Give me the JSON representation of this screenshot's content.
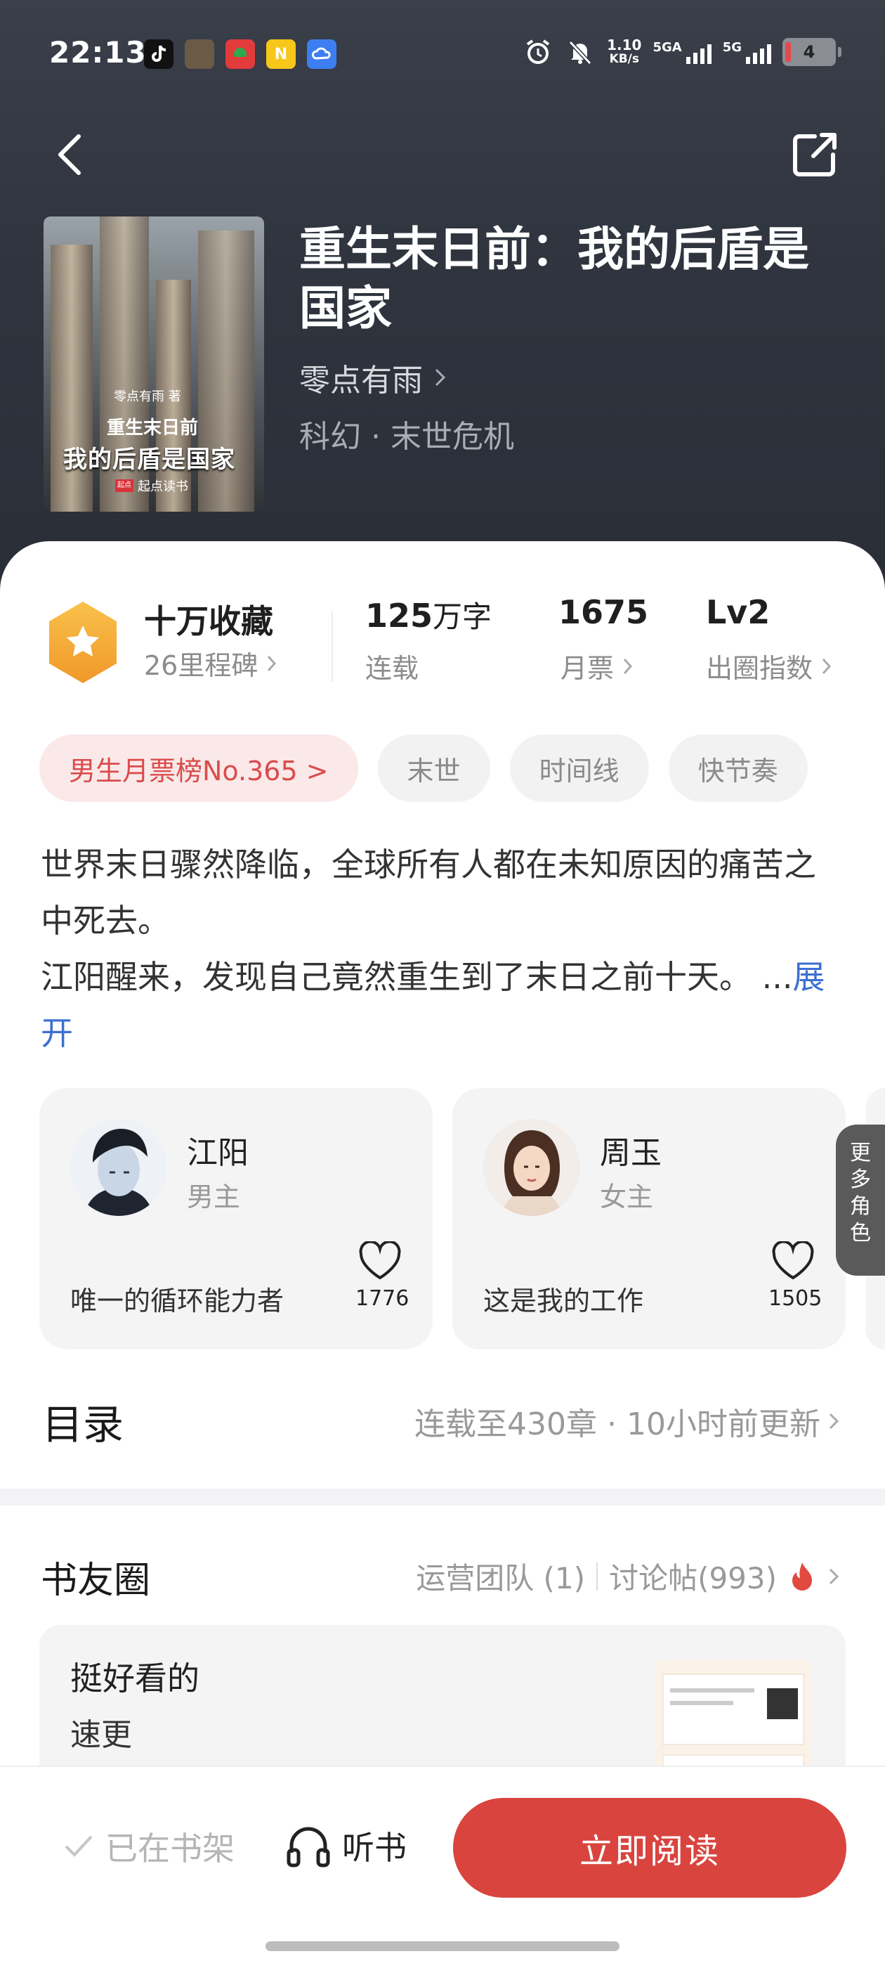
{
  "status_bar": {
    "time": "22:13",
    "net_speed_value": "1.10",
    "net_speed_unit": "KB/s",
    "sim1_label": "5GA",
    "sim2_label": "5G",
    "battery_level": "4"
  },
  "book": {
    "title": "重生末日前：我的后盾是国家",
    "author": "零点有雨",
    "genre": "科幻 · 末世危机",
    "cover": {
      "author_line": "零点有雨 著",
      "title_line1": "重生末日前",
      "title_line2": "我的后盾是国家",
      "publisher_badge": "起点",
      "publisher": "起点读书"
    }
  },
  "stats": {
    "collect_main": "十万收藏",
    "collect_sub": "26里程碑",
    "words_value": "125",
    "words_unit": "万字",
    "words_sub": "连载",
    "votes_value": "1675",
    "votes_sub": "月票",
    "level_value": "Lv2",
    "level_sub": "出圈指数"
  },
  "tags": [
    "男生月票榜No.365 >",
    "末世",
    "时间线",
    "快节奏"
  ],
  "synopsis": {
    "line1": "世界末日骤然降临，全球所有人都在未知原因的痛苦之中死去。",
    "line2": "江阳醒来，发现自己竟然重生到了末日之前十天。",
    "ellipsis": "...",
    "expand": "展开"
  },
  "characters": [
    {
      "name": "江阳",
      "role": "男主",
      "desc": "唯一的循环能力者",
      "likes": "1776"
    },
    {
      "name": "周玉",
      "role": "女主",
      "desc": "这是我的工作",
      "likes": "1505"
    }
  ],
  "more_characters": "更多角色",
  "toc": {
    "title": "目录",
    "info": "连载至430章 · 10小时前更新"
  },
  "friends": {
    "title": "书友圈",
    "ops_team": "运营团队 (1)",
    "discussions": "讨论帖(993)",
    "post_title": "挺好看的",
    "post_sub": "速更"
  },
  "bottom_bar": {
    "shelf": "已在书架",
    "listen": "听书",
    "read": "立即阅读"
  },
  "colors": {
    "accent_red": "#d9443f",
    "link_blue": "#3c6fd1",
    "badge_orange": "#f5a623"
  }
}
